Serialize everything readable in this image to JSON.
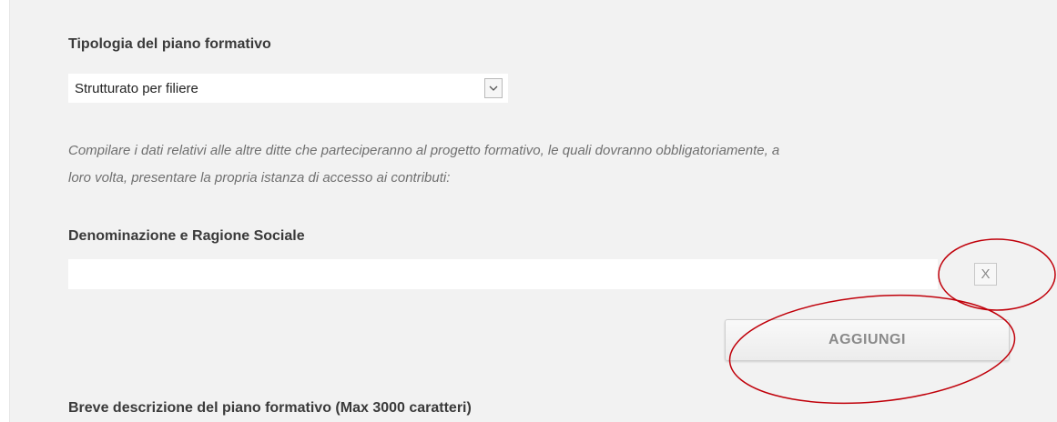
{
  "form": {
    "tipologia_label": "Tipologia del piano formativo",
    "tipologia_value": "Strutturato per filiere",
    "note_line1": "Compilare i dati relativi alle altre ditte che parteciperanno al progetto formativo, le quali dovranno obbligatoriamente, a",
    "note_line2": "loro volta, presentare la propria istanza di accesso ai contributi:",
    "denominazione_label": "Denominazione e Ragione Sociale",
    "denominazione_value": "",
    "remove_label": "X",
    "add_label": "AGGIUNGI",
    "descrizione_label": "Breve descrizione del piano formativo (Max 3000 caratteri)"
  },
  "icons": {
    "select_arrow": "chevron-down-icon"
  },
  "colors": {
    "panel_bg": "#f2f2f2",
    "annotation": "#c0000a"
  }
}
